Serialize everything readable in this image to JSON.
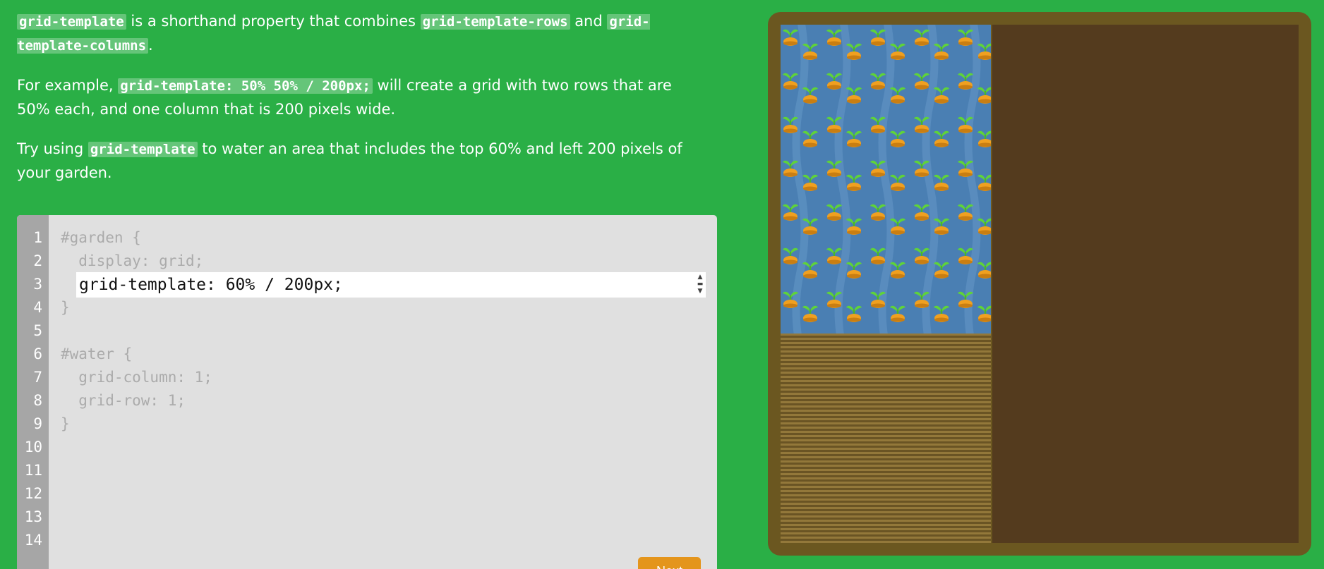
{
  "instructions": {
    "p1": {
      "code1": "grid-template",
      "text1": " is a shorthand property that combines ",
      "code2": "grid-template-rows",
      "text2": " and ",
      "code3": "grid-template-columns",
      "text3": "."
    },
    "p2": {
      "text1": "For example, ",
      "code1": "grid-template: 50% 50% / 200px;",
      "text2": " will create a grid with two rows that are 50% each, and one column that is 200 pixels wide."
    },
    "p3": {
      "text1": "Try using ",
      "code1": "grid-template",
      "text2": " to water an area that includes the top 60% and left 200 pixels of your garden."
    }
  },
  "editor": {
    "line_numbers": [
      "1",
      "2",
      "3",
      "4",
      "5",
      "6",
      "7",
      "8",
      "9",
      "10",
      "11",
      "12",
      "13",
      "14"
    ],
    "lines": {
      "l1": "#garden {",
      "l2": "  display: grid;",
      "l4": "}",
      "l6": "#water {",
      "l7": "  grid-column: 1;",
      "l8": "  grid-row: 1;",
      "l9": "}"
    },
    "input_value": "grid-template: 60% / 200px;",
    "next_label": "Next"
  },
  "colors": {
    "background": "#2aaf46",
    "editor_bg": "#e0e0e0",
    "gutter": "#a6a6a6",
    "water": "#4a7fb3",
    "soil_dark": "#543b1e",
    "frame": "#6b5720",
    "next_button": "#e4951c"
  },
  "garden": {
    "icons": [
      "carrot-icon",
      "water-tile",
      "soil-tile"
    ]
  }
}
